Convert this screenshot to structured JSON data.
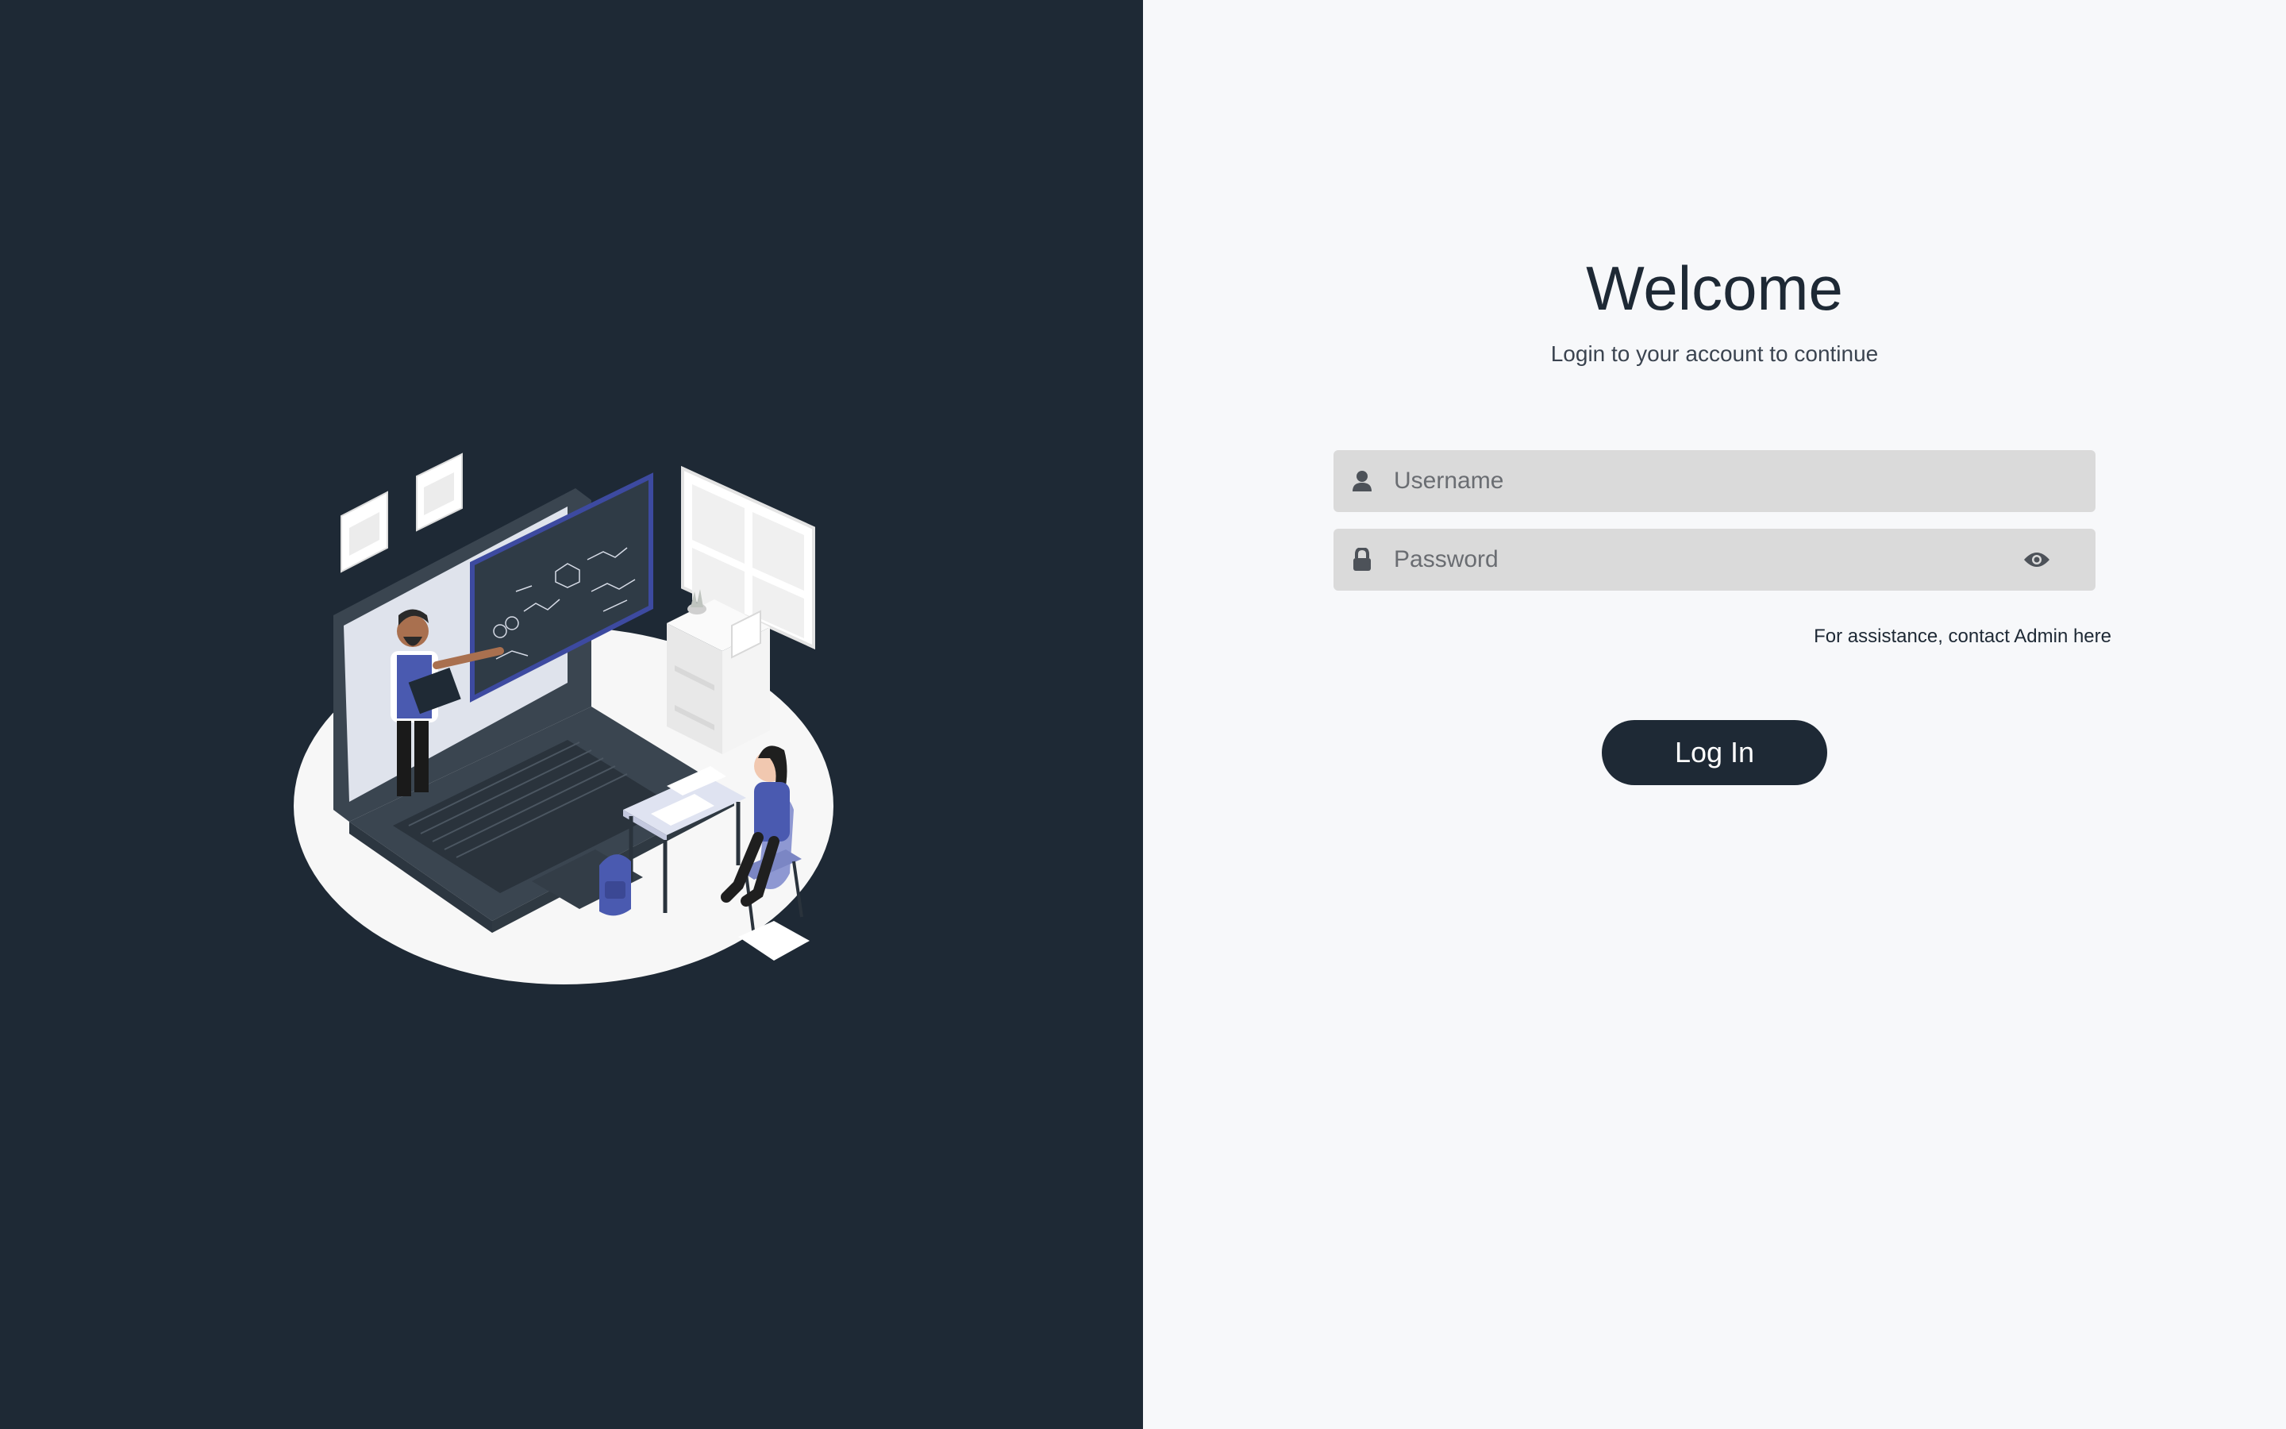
{
  "welcome": {
    "title": "Welcome",
    "subtitle": "Login to your account to continue"
  },
  "form": {
    "username": {
      "placeholder": "Username",
      "value": "",
      "icon": "user-icon"
    },
    "password": {
      "placeholder": "Password",
      "value": "",
      "icon": "lock-icon",
      "toggle_icon": "eye-icon"
    },
    "assistance_text": "For assistance, contact Admin here",
    "login_label": "Log In"
  },
  "illustration": {
    "description_icon": "online-classroom-illustration"
  },
  "colors": {
    "dark_panel": "#1e2935",
    "light_panel": "#f7f8fa",
    "input_bg": "#dadada",
    "button_bg": "#1e2935",
    "accent_blue": "#4a5ab0"
  }
}
